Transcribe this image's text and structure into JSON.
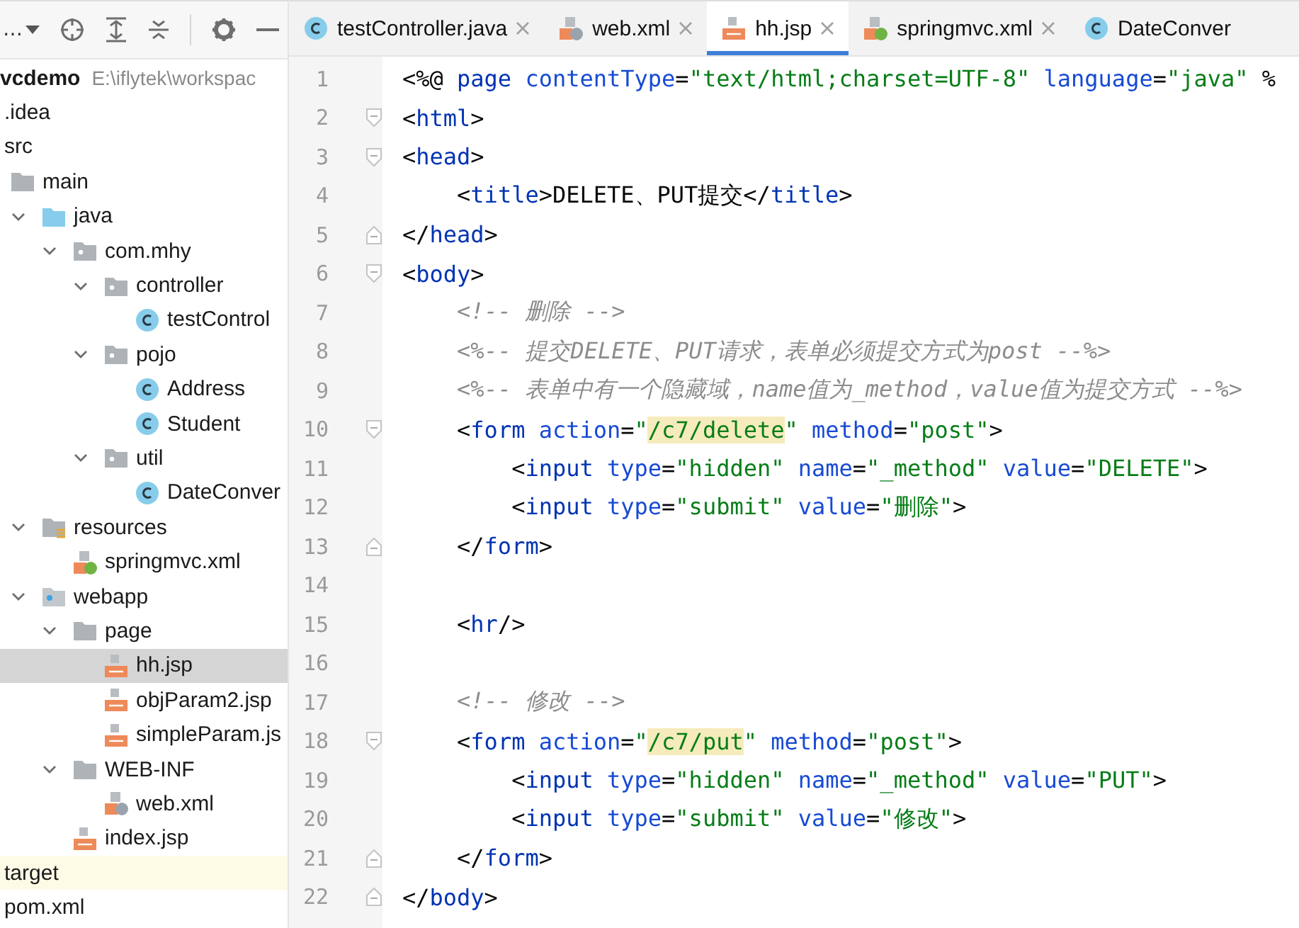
{
  "project_toolbar": {
    "label": "…"
  },
  "tree": [
    {
      "label": "vcdemo",
      "path": "E:\\iflytek\\workspac",
      "selected": false,
      "excluded": false,
      "children": [
        {
          "label": ".idea",
          "selected": false,
          "excluded": false
        },
        {
          "label": "src",
          "selected": false,
          "excluded": false,
          "children": [
            {
              "label": "main",
              "kind": "folder",
              "selected": false,
              "excluded": false,
              "children": [
                {
                  "label": "java",
                  "kind": "source",
                  "expanded": true,
                  "selected": false,
                  "excluded": false,
                  "children": [
                    {
                      "label": "com.mhy",
                      "kind": "package",
                      "expanded": true,
                      "selected": false,
                      "excluded": false,
                      "children": [
                        {
                          "label": "controller",
                          "kind": "package",
                          "expanded": true,
                          "selected": false,
                          "excluded": false,
                          "children": [
                            {
                              "label": "testControl",
                              "kind": "class",
                              "selected": false,
                              "excluded": false
                            }
                          ]
                        },
                        {
                          "label": "pojo",
                          "kind": "package",
                          "expanded": true,
                          "selected": false,
                          "excluded": false,
                          "children": [
                            {
                              "label": "Address",
                              "kind": "class",
                              "selected": false,
                              "excluded": false
                            },
                            {
                              "label": "Student",
                              "kind": "class",
                              "selected": false,
                              "excluded": false
                            }
                          ]
                        },
                        {
                          "label": "util",
                          "kind": "package",
                          "expanded": true,
                          "selected": false,
                          "excluded": false,
                          "children": [
                            {
                              "label": "DateConver",
                              "kind": "class",
                              "selected": false,
                              "excluded": false
                            }
                          ]
                        }
                      ]
                    }
                  ]
                },
                {
                  "label": "resources",
                  "kind": "resources",
                  "expanded": true,
                  "selected": false,
                  "excluded": false,
                  "children": [
                    {
                      "label": "springmvc.xml",
                      "kind": "spring",
                      "selected": false,
                      "excluded": false
                    }
                  ]
                },
                {
                  "label": "webapp",
                  "kind": "webapp",
                  "expanded": true,
                  "selected": false,
                  "excluded": false,
                  "children": [
                    {
                      "label": "page",
                      "kind": "folder",
                      "expanded": true,
                      "selected": false,
                      "excluded": false,
                      "children": [
                        {
                          "label": "hh.jsp",
                          "kind": "jsp",
                          "selected": true,
                          "excluded": false
                        },
                        {
                          "label": "objParam2.jsp",
                          "kind": "jsp",
                          "selected": false,
                          "excluded": false
                        },
                        {
                          "label": "simpleParam.js",
                          "kind": "jsp",
                          "selected": false,
                          "excluded": false
                        }
                      ]
                    },
                    {
                      "label": "WEB-INF",
                      "kind": "folder",
                      "expanded": true,
                      "selected": false,
                      "excluded": false,
                      "children": [
                        {
                          "label": "web.xml",
                          "kind": "webxml",
                          "selected": false,
                          "excluded": false
                        }
                      ]
                    },
                    {
                      "label": "index.jsp",
                      "kind": "jsp",
                      "selected": false,
                      "excluded": false
                    }
                  ]
                }
              ]
            }
          ]
        },
        {
          "label": "target",
          "selected": false,
          "excluded": true
        },
        {
          "label": "pom.xml",
          "selected": false,
          "excluded": false
        }
      ]
    }
  ],
  "tabs": [
    {
      "label": "testController.java",
      "kind": "class",
      "selected": false
    },
    {
      "label": "web.xml",
      "kind": "webxml",
      "selected": false
    },
    {
      "label": "hh.jsp",
      "kind": "jsp",
      "selected": true
    },
    {
      "label": "springmvc.xml",
      "kind": "spring",
      "selected": false
    },
    {
      "label": "DateConver",
      "kind": "class",
      "selected": false
    }
  ],
  "lines": [
    {
      "number": "1",
      "kind": "plain",
      "tokens": [
        {
          "kind": "p",
          "text": "<%@ "
        },
        {
          "kind": "tag",
          "text": "page "
        },
        {
          "kind": "attr",
          "text": "contentType"
        },
        {
          "kind": "p",
          "text": "="
        },
        {
          "kind": "str",
          "text": "\"text/html;charset=UTF-8\" "
        },
        {
          "kind": "attr",
          "text": "language"
        },
        {
          "kind": "p",
          "text": "="
        },
        {
          "kind": "str",
          "text": "\"java\" "
        },
        {
          "kind": "p",
          "text": "%"
        }
      ]
    },
    {
      "number": "2",
      "kind": "fold-start",
      "tokens": [
        {
          "kind": "p",
          "text": "<"
        },
        {
          "kind": "tag",
          "text": "html"
        },
        {
          "kind": "p",
          "text": ">"
        }
      ]
    },
    {
      "number": "3",
      "kind": "fold-start",
      "tokens": [
        {
          "kind": "p",
          "text": "<"
        },
        {
          "kind": "tag",
          "text": "head"
        },
        {
          "kind": "p",
          "text": ">"
        }
      ]
    },
    {
      "number": "4",
      "kind": "plain",
      "tokens": [
        {
          "kind": "p",
          "text": "    <"
        },
        {
          "kind": "tag",
          "text": "title"
        },
        {
          "kind": "p",
          "text": ">DELETE、PUT提交</"
        },
        {
          "kind": "tag",
          "text": "title"
        },
        {
          "kind": "p",
          "text": ">"
        }
      ]
    },
    {
      "number": "5",
      "kind": "fold-end",
      "tokens": [
        {
          "kind": "p",
          "text": "</"
        },
        {
          "kind": "tag",
          "text": "head"
        },
        {
          "kind": "p",
          "text": ">"
        }
      ]
    },
    {
      "number": "6",
      "kind": "fold-start",
      "tokens": [
        {
          "kind": "p",
          "text": "<"
        },
        {
          "kind": "tag",
          "text": "body"
        },
        {
          "kind": "p",
          "text": ">"
        }
      ]
    },
    {
      "number": "7",
      "kind": "plain",
      "tokens": [
        {
          "kind": "comment",
          "text": "    <!-- 删除 -->"
        }
      ]
    },
    {
      "number": "8",
      "kind": "plain",
      "tokens": [
        {
          "kind": "comment",
          "text": "    <%-- 提交DELETE、PUT请求，表单必须提交方式为post --%>"
        }
      ]
    },
    {
      "number": "9",
      "kind": "plain",
      "tokens": [
        {
          "kind": "comment",
          "text": "    <%-- 表单中有一个隐藏域，name值为_method，value值为提交方式 --%>"
        }
      ]
    },
    {
      "number": "10",
      "kind": "fold-start",
      "tokens": [
        {
          "kind": "p",
          "text": "    <"
        },
        {
          "kind": "tag",
          "text": "form "
        },
        {
          "kind": "attr",
          "text": "action"
        },
        {
          "kind": "p",
          "text": "="
        },
        {
          "kind": "str",
          "text": "\""
        },
        {
          "kind": "hl",
          "text": "/c7/delete"
        },
        {
          "kind": "str",
          "text": "\" "
        },
        {
          "kind": "attr",
          "text": "method"
        },
        {
          "kind": "p",
          "text": "="
        },
        {
          "kind": "str",
          "text": "\"post\""
        },
        {
          "kind": "p",
          "text": ">"
        }
      ]
    },
    {
      "number": "11",
      "kind": "plain",
      "tokens": [
        {
          "kind": "p",
          "text": "        <"
        },
        {
          "kind": "tag",
          "text": "input "
        },
        {
          "kind": "attr",
          "text": "type"
        },
        {
          "kind": "p",
          "text": "="
        },
        {
          "kind": "str",
          "text": "\"hidden\" "
        },
        {
          "kind": "attr",
          "text": "name"
        },
        {
          "kind": "p",
          "text": "="
        },
        {
          "kind": "str",
          "text": "\"_method\" "
        },
        {
          "kind": "attr",
          "text": "value"
        },
        {
          "kind": "p",
          "text": "="
        },
        {
          "kind": "str",
          "text": "\"DELETE\""
        },
        {
          "kind": "p",
          "text": ">"
        }
      ]
    },
    {
      "number": "12",
      "kind": "plain",
      "tokens": [
        {
          "kind": "p",
          "text": "        <"
        },
        {
          "kind": "tag",
          "text": "input "
        },
        {
          "kind": "attr",
          "text": "type"
        },
        {
          "kind": "p",
          "text": "="
        },
        {
          "kind": "str",
          "text": "\"submit\" "
        },
        {
          "kind": "attr",
          "text": "value"
        },
        {
          "kind": "p",
          "text": "="
        },
        {
          "kind": "str",
          "text": "\"删除\""
        },
        {
          "kind": "p",
          "text": ">"
        }
      ]
    },
    {
      "number": "13",
      "kind": "fold-end",
      "tokens": [
        {
          "kind": "p",
          "text": "    </"
        },
        {
          "kind": "tag",
          "text": "form"
        },
        {
          "kind": "p",
          "text": ">"
        }
      ]
    },
    {
      "number": "14",
      "kind": "plain"
    },
    {
      "number": "15",
      "kind": "plain",
      "tokens": [
        {
          "kind": "p",
          "text": "    <"
        },
        {
          "kind": "tag",
          "text": "hr"
        },
        {
          "kind": "p",
          "text": "/>"
        }
      ]
    },
    {
      "number": "16",
      "kind": "plain"
    },
    {
      "number": "17",
      "kind": "plain",
      "tokens": [
        {
          "kind": "comment",
          "text": "    <!-- 修改 -->"
        }
      ]
    },
    {
      "number": "18",
      "kind": "fold-start",
      "tokens": [
        {
          "kind": "p",
          "text": "    <"
        },
        {
          "kind": "tag",
          "text": "form "
        },
        {
          "kind": "attr",
          "text": "action"
        },
        {
          "kind": "p",
          "text": "="
        },
        {
          "kind": "str",
          "text": "\""
        },
        {
          "kind": "hl",
          "text": "/c7/put"
        },
        {
          "kind": "str",
          "text": "\" "
        },
        {
          "kind": "attr",
          "text": "method"
        },
        {
          "kind": "p",
          "text": "="
        },
        {
          "kind": "str",
          "text": "\"post\""
        },
        {
          "kind": "p",
          "text": ">"
        }
      ]
    },
    {
      "number": "19",
      "kind": "plain",
      "tokens": [
        {
          "kind": "p",
          "text": "        <"
        },
        {
          "kind": "tag",
          "text": "input "
        },
        {
          "kind": "attr",
          "text": "type"
        },
        {
          "kind": "p",
          "text": "="
        },
        {
          "kind": "str",
          "text": "\"hidden\" "
        },
        {
          "kind": "attr",
          "text": "name"
        },
        {
          "kind": "p",
          "text": "="
        },
        {
          "kind": "str",
          "text": "\"_method\" "
        },
        {
          "kind": "attr",
          "text": "value"
        },
        {
          "kind": "p",
          "text": "="
        },
        {
          "kind": "str",
          "text": "\"PUT\""
        },
        {
          "kind": "p",
          "text": ">"
        }
      ]
    },
    {
      "number": "20",
      "kind": "plain",
      "tokens": [
        {
          "kind": "p",
          "text": "        <"
        },
        {
          "kind": "tag",
          "text": "input "
        },
        {
          "kind": "attr",
          "text": "type"
        },
        {
          "kind": "p",
          "text": "="
        },
        {
          "kind": "str",
          "text": "\"submit\" "
        },
        {
          "kind": "attr",
          "text": "value"
        },
        {
          "kind": "p",
          "text": "="
        },
        {
          "kind": "str",
          "text": "\"修改\""
        },
        {
          "kind": "p",
          "text": ">"
        }
      ]
    },
    {
      "number": "21",
      "kind": "fold-end",
      "tokens": [
        {
          "kind": "p",
          "text": "    </"
        },
        {
          "kind": "tag",
          "text": "form"
        },
        {
          "kind": "p",
          "text": ">"
        }
      ]
    },
    {
      "number": "22",
      "kind": "fold-end",
      "tokens": [
        {
          "kind": "p",
          "text": "</"
        },
        {
          "kind": "tag",
          "text": "body"
        },
        {
          "kind": "p",
          "text": ">"
        }
      ]
    }
  ]
}
